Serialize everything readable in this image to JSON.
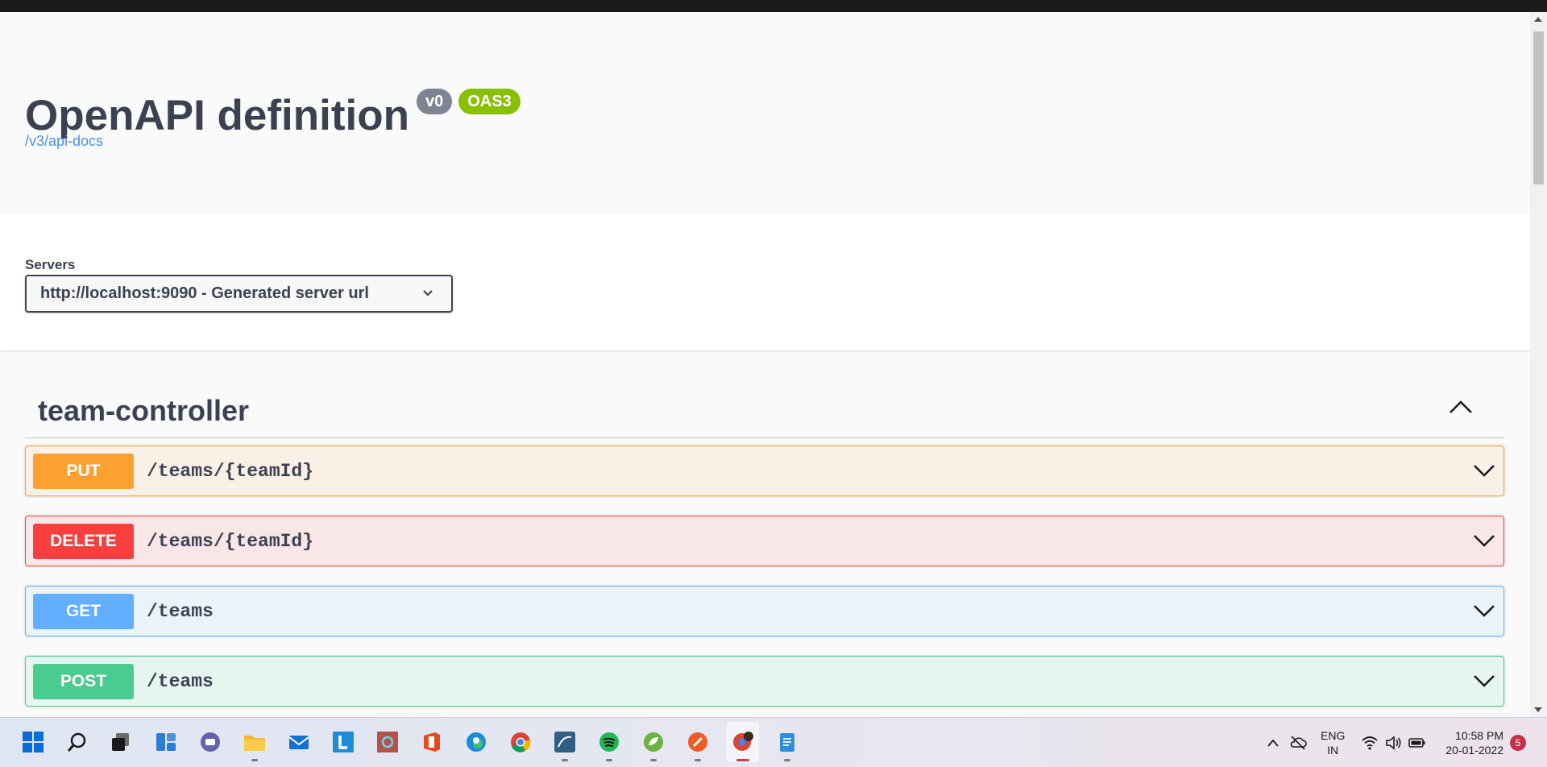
{
  "info": {
    "title": "OpenAPI definition",
    "version_badge": "v0",
    "oas_badge": "OAS3",
    "api_docs_link": "/v3/api-docs"
  },
  "servers": {
    "label": "Servers",
    "selected": "http://localhost:9090 - Generated server url"
  },
  "controller": {
    "name": "team-controller",
    "operations": [
      {
        "method": "PUT",
        "path": "/teams/{teamId}"
      },
      {
        "method": "DELETE",
        "path": "/teams/{teamId}"
      },
      {
        "method": "GET",
        "path": "/teams"
      },
      {
        "method": "POST",
        "path": "/teams"
      }
    ]
  },
  "taskbar": {
    "icons": [
      "windows-start-icon",
      "search-icon",
      "task-view-icon",
      "widgets-icon",
      "teams-chat-icon",
      "file-explorer-icon",
      "mail-icon",
      "l-app-icon",
      "cortana-app-icon",
      "office-icon",
      "edge-icon",
      "chrome-icon",
      "mysql-workbench-icon",
      "spotify-icon",
      "spring-tool-icon",
      "postman-icon",
      "chrome-profile-icon",
      "notepad-icon"
    ],
    "language_top": "ENG",
    "language_bottom": "IN",
    "time": "10:58 PM",
    "date": "20-01-2022",
    "notification_count": "5"
  },
  "colors": {
    "put": "#fca130",
    "delete": "#f93e3e",
    "get": "#61affe",
    "post": "#49cc90",
    "link": "#4990e2",
    "oas_badge": "#89bf04",
    "version_badge": "#7d8492"
  }
}
